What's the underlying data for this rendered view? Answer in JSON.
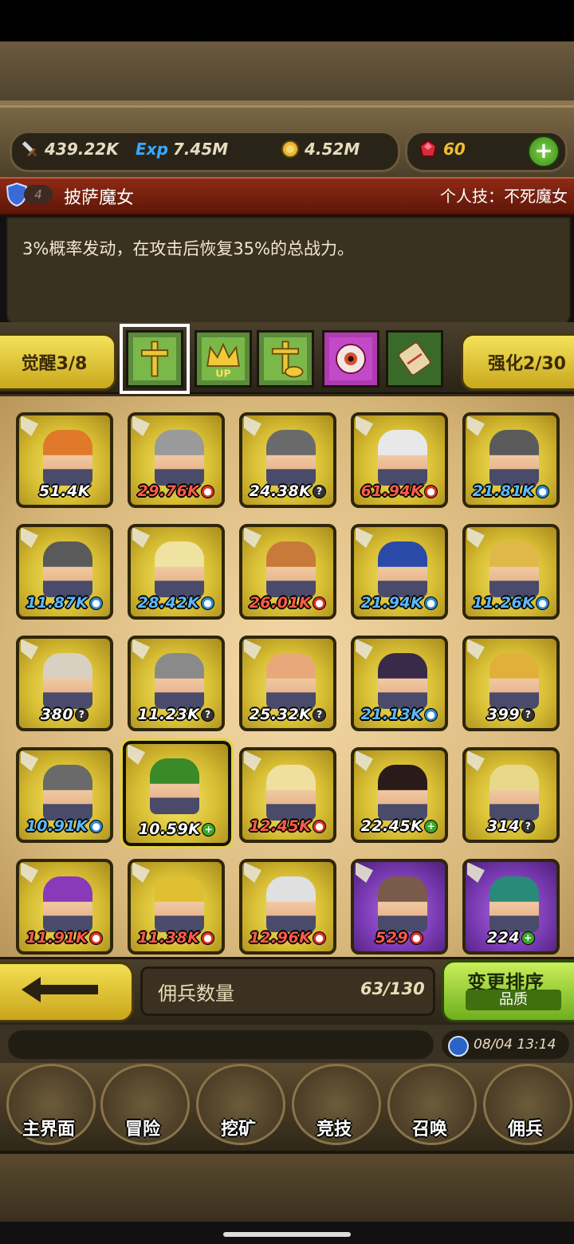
{
  "stats": {
    "attack": "439.22K",
    "exp_label": "Exp",
    "exp": "7.45M",
    "gold": "4.52M",
    "gems": "60",
    "add": "+"
  },
  "hero": {
    "rank": "4",
    "name": "披萨魔女",
    "skill": "个人技：不死魔女",
    "description": "3%概率发动，在攻击后恢复35%的总战力。"
  },
  "awaken_label": "觉醒3/8",
  "enhance_label": "强化2/30",
  "equipment": [
    "golden-cross-icon",
    "crown-up-icon",
    "cross-handshake-icon",
    "eye-orb-icon",
    "scroll-icon"
  ],
  "equipment_up_label": "UP",
  "mercenaries": [
    {
      "power": "51.4K",
      "tag": "",
      "color": "#ffffff",
      "rarity": "gold",
      "avatar": "#e07a2a"
    },
    {
      "power": "29.76K",
      "tag": "fire",
      "color": "#ff5a4a",
      "rarity": "gold",
      "avatar": "#9a9a9a"
    },
    {
      "power": "24.38K",
      "tag": "unknown",
      "color": "#ffffff",
      "rarity": "gold",
      "avatar": "#6a6a6a"
    },
    {
      "power": "61.94K",
      "tag": "fire",
      "color": "#ff5a4a",
      "rarity": "gold",
      "avatar": "#e8e8e8"
    },
    {
      "power": "21.81K",
      "tag": "water",
      "color": "#5ab8ff",
      "rarity": "gold",
      "avatar": "#5a5a5a"
    },
    {
      "power": "11.87K",
      "tag": "water",
      "color": "#5ab8ff",
      "rarity": "gold",
      "avatar": "#5a5a5a"
    },
    {
      "power": "28.42K",
      "tag": "water",
      "color": "#5ab8ff",
      "rarity": "gold",
      "avatar": "#f0e2a0"
    },
    {
      "power": "26.01K",
      "tag": "fire",
      "color": "#ff5a4a",
      "rarity": "gold",
      "avatar": "#c87a3a"
    },
    {
      "power": "21.94K",
      "tag": "water",
      "color": "#5ab8ff",
      "rarity": "gold",
      "avatar": "#2a4aa8"
    },
    {
      "power": "11.26K",
      "tag": "water",
      "color": "#5ab8ff",
      "rarity": "gold",
      "avatar": "#e0b84a"
    },
    {
      "power": "380",
      "tag": "unknown",
      "color": "#ffffff",
      "rarity": "gold",
      "avatar": "#d8d0c0"
    },
    {
      "power": "11.23K",
      "tag": "unknown",
      "color": "#ffffff",
      "rarity": "gold",
      "avatar": "#8a8a8a"
    },
    {
      "power": "25.32K",
      "tag": "unknown",
      "color": "#ffffff",
      "rarity": "gold",
      "avatar": "#e8a87a"
    },
    {
      "power": "21.13K",
      "tag": "water",
      "color": "#5ab8ff",
      "rarity": "gold",
      "avatar": "#3a2a4a"
    },
    {
      "power": "399",
      "tag": "unknown",
      "color": "#ffffff",
      "rarity": "gold",
      "avatar": "#e0b03a"
    },
    {
      "power": "10.91K",
      "tag": "water",
      "color": "#5ab8ff",
      "rarity": "gold",
      "avatar": "#6a6a6a"
    },
    {
      "power": "10.59K",
      "tag": "nature",
      "color": "#ffffff",
      "rarity": "gold",
      "avatar": "#3a8a2a",
      "selected": true
    },
    {
      "power": "12.45K",
      "tag": "fire",
      "color": "#ff5a4a",
      "rarity": "gold",
      "avatar": "#f0e0a0"
    },
    {
      "power": "22.45K",
      "tag": "nature",
      "color": "#ffffff",
      "rarity": "gold",
      "avatar": "#2a1a1a"
    },
    {
      "power": "314",
      "tag": "unknown",
      "color": "#ffffff",
      "rarity": "gold",
      "avatar": "#e8d88a"
    },
    {
      "power": "11.91K",
      "tag": "fire",
      "color": "#ff5a4a",
      "rarity": "gold",
      "avatar": "#8a3ab8"
    },
    {
      "power": "11.38K",
      "tag": "fire",
      "color": "#ff5a4a",
      "rarity": "gold",
      "avatar": "#e0c030"
    },
    {
      "power": "12.96K",
      "tag": "fire",
      "color": "#ff5a4a",
      "rarity": "gold",
      "avatar": "#e0e0e0"
    },
    {
      "power": "529",
      "tag": "fire",
      "color": "#ff5a4a",
      "rarity": "purple",
      "avatar": "#7a5a4a"
    },
    {
      "power": "224",
      "tag": "nature",
      "color": "#ffffff",
      "rarity": "purple",
      "avatar": "#2a8a7a"
    }
  ],
  "tag_glyphs": {
    "fire": "●",
    "water": "●",
    "unknown": "?",
    "nature": "+"
  },
  "tag_colors": {
    "fire": "#d8322a",
    "water": "#2a8ad8",
    "unknown": "#333333",
    "nature": "#3aa82a"
  },
  "back_icon": "arrow-left-icon",
  "mercenary_count_label": "佣兵数量",
  "mercenary_count": "63/130",
  "sort_label": "变更排序",
  "sort_mode": "品质",
  "datetime": "08/04 13:14",
  "nav": [
    {
      "label": "主界面",
      "icon": "map-scroll-icon"
    },
    {
      "label": "冒险",
      "icon": "island-icon"
    },
    {
      "label": "挖矿",
      "icon": "pickaxe-icon"
    },
    {
      "label": "竞技",
      "icon": "crossed-swords-icon"
    },
    {
      "label": "召唤",
      "icon": "summon-scroll-icon"
    },
    {
      "label": "佣兵",
      "icon": "tent-icon"
    }
  ]
}
